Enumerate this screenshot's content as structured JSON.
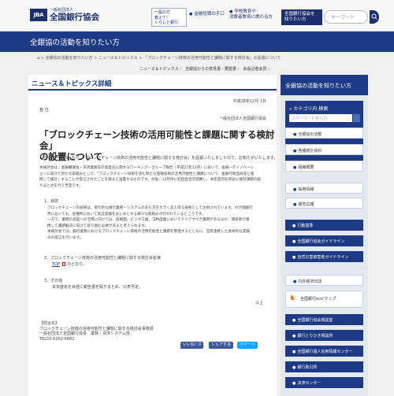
{
  "header": {
    "logo_abbr": "JBA",
    "logo_small": "一般社団法人",
    "logo_name": "全国銀行協会",
    "box_lines": [
      "一般の方",
      "教えて！",
      "くらしと銀行"
    ],
    "consult": "金融犯罪の手口",
    "school_lines": [
      "学校教育や",
      "消費者教育に携わる方"
    ],
    "member_btn_lines": [
      "全国銀行協会を",
      "知りたい方"
    ],
    "search_placeholder": "キーワード"
  },
  "banner_title": "全銀協の活動を知りたい方",
  "breadcrumb": {
    "items": [
      "全銀協の活動を知りたい方",
      "ニュース＆トピックス",
      "「ブロックチェーン技術の活用可能性と課題に関する検討会」の設置について"
    ],
    "sep": ">"
  },
  "main": {
    "section_title": "ニュース＆トピックス詳細",
    "sublinks": [
      "ニュース＆トピックス",
      "全銀協からの意見書・要望書",
      "会長記者会見"
    ],
    "date": "平成28年12月 1日",
    "to": "各 位",
    "from": "一般社団法人全国銀行協会",
    "title_lines": [
      "「ブロックチェーン技術の活用可能性と課題に関する検討会」",
      "の設置について"
    ],
    "intro": "今般、下記のとおり、「ブロックチェーン技術の活用可能性と課題に関する検討会」を設置いたしましたので、お知らせいたします。",
    "body_lines": [
      "本検討会は、金融審議会・決済業務等の高度化に関するワーキング・グループ報告（平成27年12月）において、金融・ITイノベーシ",
      "ョンに向けた新たな取組みとして、「ブロックチェーン技術を含む新たな金融技術の活用可能性と課題について、金融行政当局等と連",
      "携して検討」することが提言されたことを踏まえ設置するものです。今後、12月中に初回会合を開催し、本年度内を目途に検討課題の取",
      "りまとめを行う予定です。"
    ],
    "item1_head": "1．目的",
    "item1_lines": [
      "ブロックチェーンの技術は、取引的な銀行業務・システムのあり方を大きく変え得る技術として注目されています。わが国銀行",
      "界においても、各種所において実証実験をはじめとする様々な取組みが行われているところです。",
      "一方で、業務の高度への活用に向けては、技術面、ビジネス面、法制度面においてクリアすべき課題があるほか、関係者が連",
      "携して課題解決に向けて取り組む必要があると考えられます。",
      "本検討会では、銀行業務におけるブロックチェーン技術の活用可能性と課題を整理するとともに、官民連携した具体的な実験",
      "みの提言を行います。"
    ],
    "item2_head": "2．ブロックチェーン技術の活用可能性と課題に関する検討会名簿",
    "item2_link": "TOP",
    "item2_tail": "のとおり。",
    "item3_head": "3．その他",
    "item3_body": "本年度末を目途に報告書を取りまとめ、公表予定。",
    "end": "以上",
    "contact_lines": [
      "【問合先】",
      "ブロックチェーン技術の活用可能性と課題に関する検討会事務局",
      "一般社団法人全国銀行協会　業務・決済システム部",
      "TEL03-6262-6682"
    ],
    "share_buttons": [
      "いいね！0",
      "シェアする",
      "ツイート"
    ]
  },
  "sidebar": {
    "header": "全銀協の活動を知りたい方",
    "category_label": "カテゴリ内 検索",
    "search_placeholder": "フリーワードを入力",
    "nav_light": [
      "全銀協の活動",
      "各種統計資料",
      "組織概要"
    ],
    "nav_light2": [
      "採用情報",
      "報告広報"
    ],
    "nav_dark": [
      "行動基準",
      "全国銀行協会ガイドライン",
      "自然災害被害者ガイドライン"
    ],
    "nav_light3": [
      "内外経済日誌"
    ],
    "map_label": "全国銀行eco'マップ",
    "nav_dark2": [
      "全国銀行協会相談室",
      "銀行とりひき相談所",
      "全国銀行個人信用情報センター",
      "銀行取引所",
      "決済センター"
    ]
  }
}
